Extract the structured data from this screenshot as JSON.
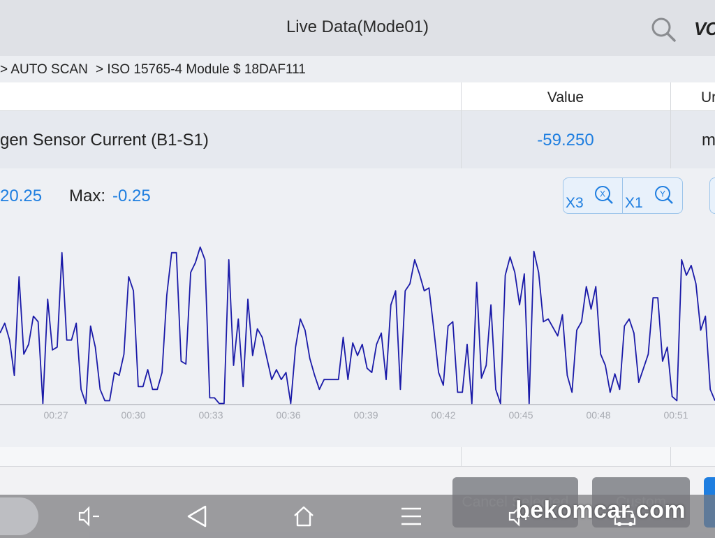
{
  "header": {
    "title": "Live Data(Mode01)",
    "brand": "VC"
  },
  "breadcrumb": {
    "item1": "> AUTO SCAN",
    "item2": "> ISO 15765-4 Module $ 18DAF111"
  },
  "table": {
    "headers": {
      "value": "Value",
      "unit": "Ur"
    },
    "row": {
      "name": "gen Sensor Current (B1-S1)",
      "value": "-59.250",
      "unit": "m"
    }
  },
  "stats": {
    "min": "20.25",
    "max_label": "Max:",
    "max": "-0.25"
  },
  "zoom": {
    "x_label": "X3",
    "y_label": "X1"
  },
  "chart_data": {
    "type": "line",
    "x_ticks": [
      "00:27",
      "00:30",
      "00:33",
      "00:36",
      "00:39",
      "00:42",
      "00:45",
      "00:48",
      "00:51"
    ],
    "y_range": [
      -120.25,
      -0.25
    ],
    "series": [
      {
        "color": "#1a1aa8",
        "values": [
          -70,
          -63,
          -75,
          -100,
          -30,
          -85,
          -78,
          -58,
          -62,
          -120,
          -46,
          -82,
          -80,
          -13,
          -75,
          -75,
          -63,
          -110,
          -120,
          -65,
          -80,
          -110,
          -118,
          -118,
          -98,
          -100,
          -85,
          -30,
          -40,
          -108,
          -108,
          -96,
          -110,
          -110,
          -98,
          -43,
          -13,
          -13,
          -90,
          -92,
          -27,
          -20,
          -9,
          -18,
          -116,
          -116,
          -120,
          -120,
          -18,
          -93,
          -60,
          -108,
          -46,
          -86,
          -67,
          -73,
          -88,
          -103,
          -96,
          -103,
          -98,
          -120,
          -80,
          -60,
          -68,
          -88,
          -100,
          -110,
          -103,
          -103,
          -103,
          -103,
          -73,
          -103,
          -77,
          -86,
          -78,
          -95,
          -98,
          -78,
          -70,
          -103,
          -50,
          -40,
          -110,
          -40,
          -35,
          -18,
          -28,
          -40,
          -38,
          -67,
          -98,
          -107,
          -65,
          -62,
          -112,
          -112,
          -78,
          -120,
          -34,
          -102,
          -93,
          -50,
          -110,
          -120,
          -29,
          -16,
          -27,
          -50,
          -28,
          -120,
          -12,
          -27,
          -62,
          -60,
          -66,
          -72,
          -57,
          -100,
          -112,
          -68,
          -62,
          -37,
          -53,
          -37,
          -85,
          -93,
          -112,
          -99,
          -110,
          -65,
          -60,
          -70,
          -105,
          -95,
          -85,
          -45,
          -45,
          -90,
          -80,
          -115,
          -118,
          -18,
          -29,
          -22,
          -35,
          -68,
          -58,
          -110,
          -118
        ]
      }
    ]
  },
  "buttons": {
    "cancel": "Cancel Selected",
    "custom": "Custom"
  },
  "watermark": "bekomcar.com"
}
